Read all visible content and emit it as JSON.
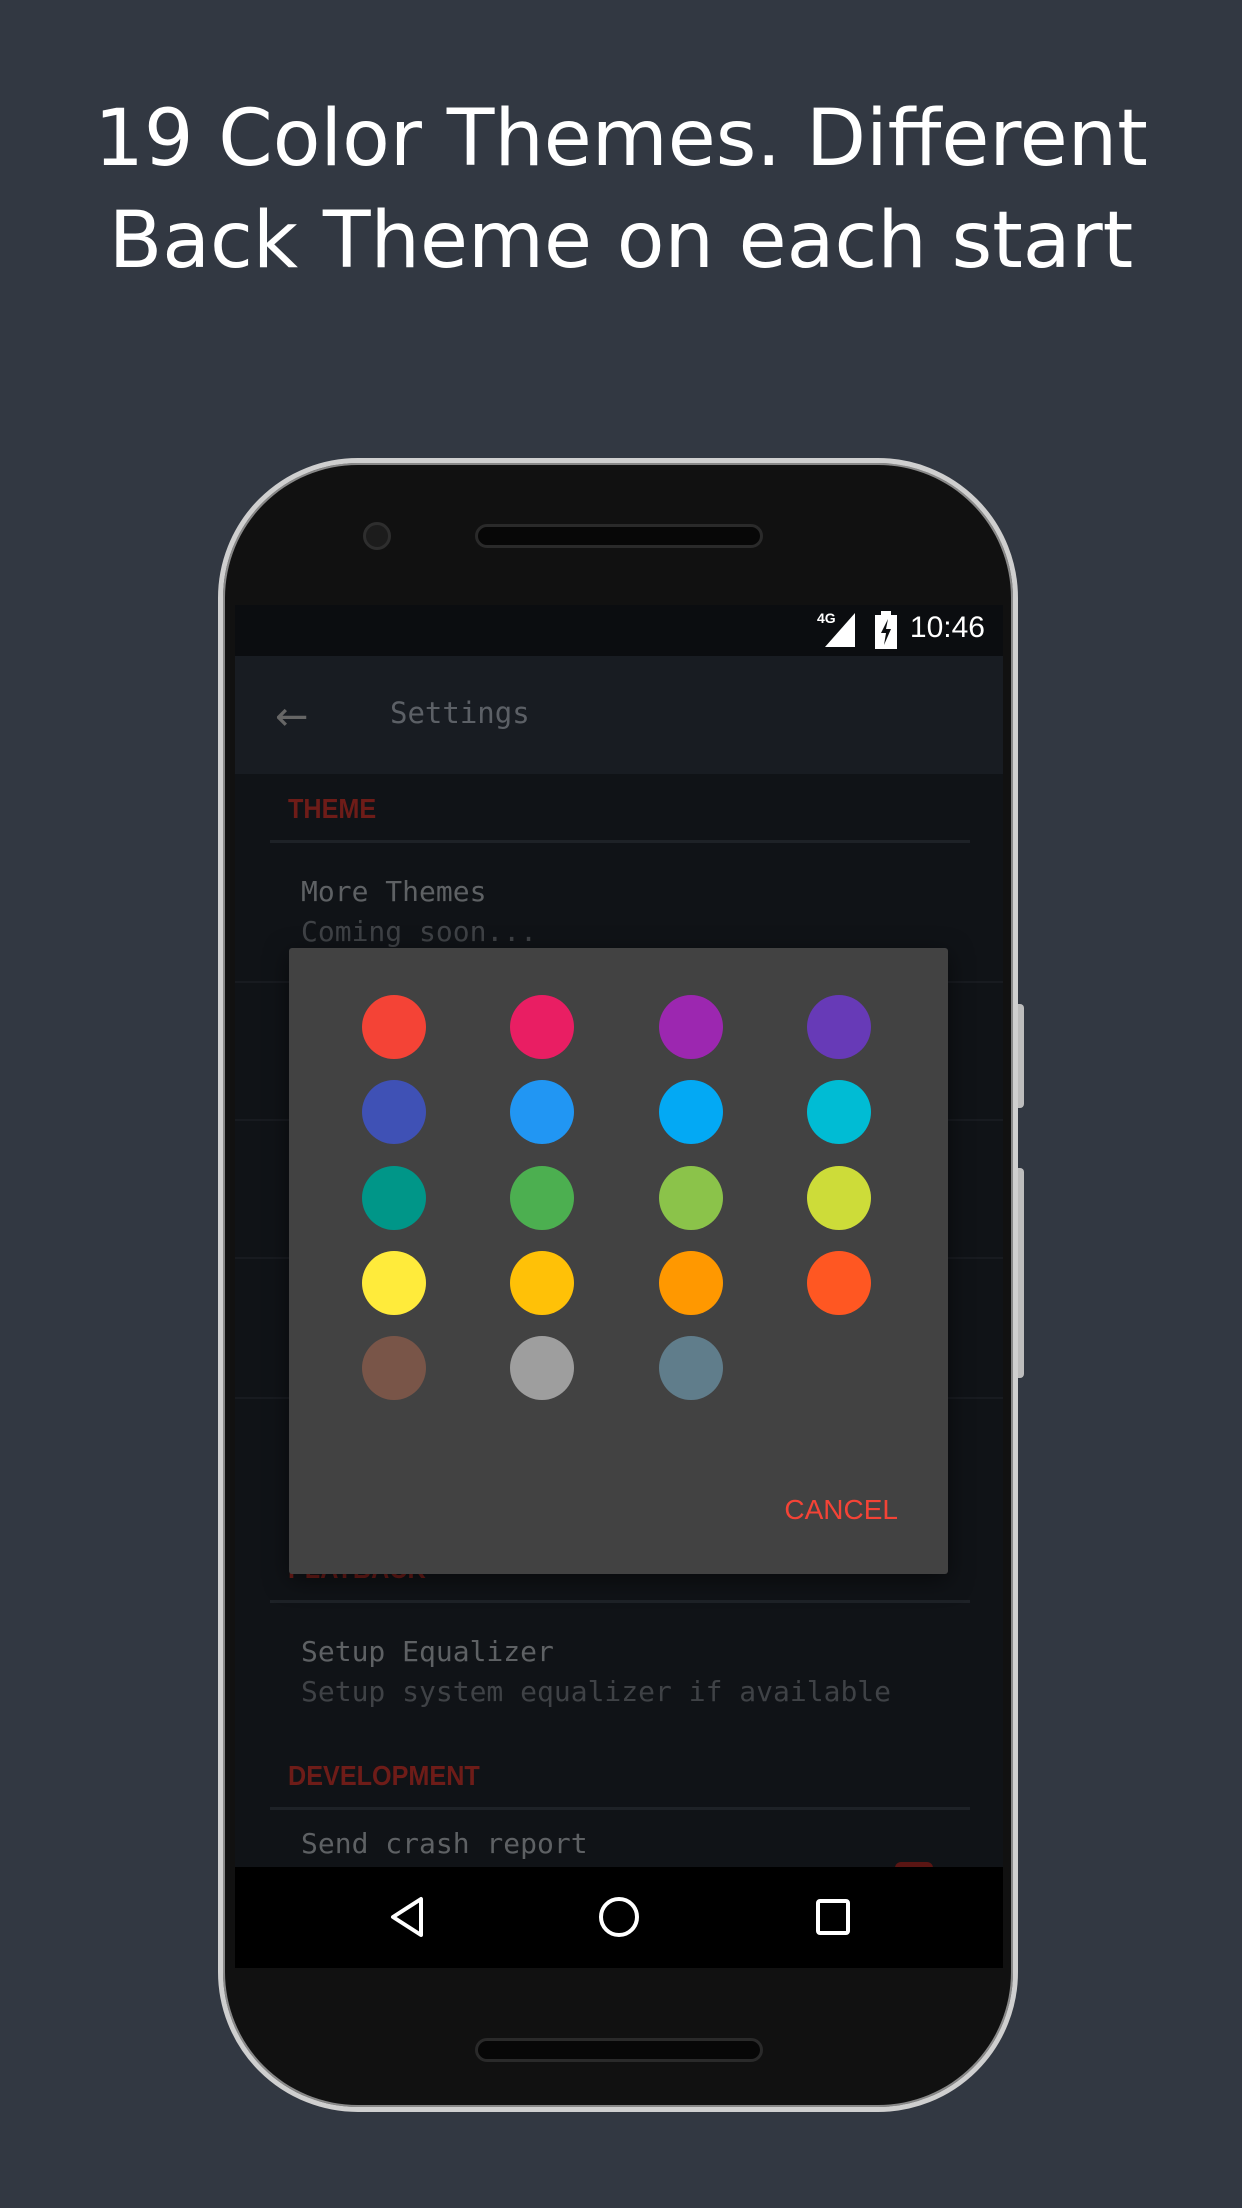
{
  "headline": {
    "line1": "19 Color Themes. Different",
    "line2": "Back Theme on each start"
  },
  "status_bar": {
    "network": "4G",
    "icons": [
      "signal-icon",
      "battery-charging-icon"
    ],
    "time": "10:46"
  },
  "toolbar": {
    "back_icon": "arrow-left-icon",
    "title": "Settings"
  },
  "settings": {
    "theme_header": "THEME",
    "more_themes": {
      "title": "More Themes",
      "subtitle": "Coming soon..."
    },
    "playback_header": "PLAYBACK",
    "equalizer": {
      "title": "Setup Equalizer",
      "subtitle": "Setup system equalizer if available"
    },
    "development_header": "DEVELOPMENT",
    "crash_report": {
      "title": "Send crash report"
    }
  },
  "dialog": {
    "colors": [
      "#F44336",
      "#E91E63",
      "#9C27B0",
      "#673AB7",
      "#3F51B5",
      "#2196F3",
      "#03A9F4",
      "#00BCD4",
      "#009688",
      "#4CAF50",
      "#8BC34A",
      "#CDDC39",
      "#FFEB3B",
      "#FFC107",
      "#FF9800",
      "#FF5722",
      "#795548",
      "#9E9E9E",
      "#607D8B"
    ],
    "cancel_label": "CANCEL",
    "accent": "#F44336"
  },
  "nav_bar": {
    "icons": [
      "back-triangle-icon",
      "home-circle-icon",
      "recents-square-icon"
    ]
  }
}
